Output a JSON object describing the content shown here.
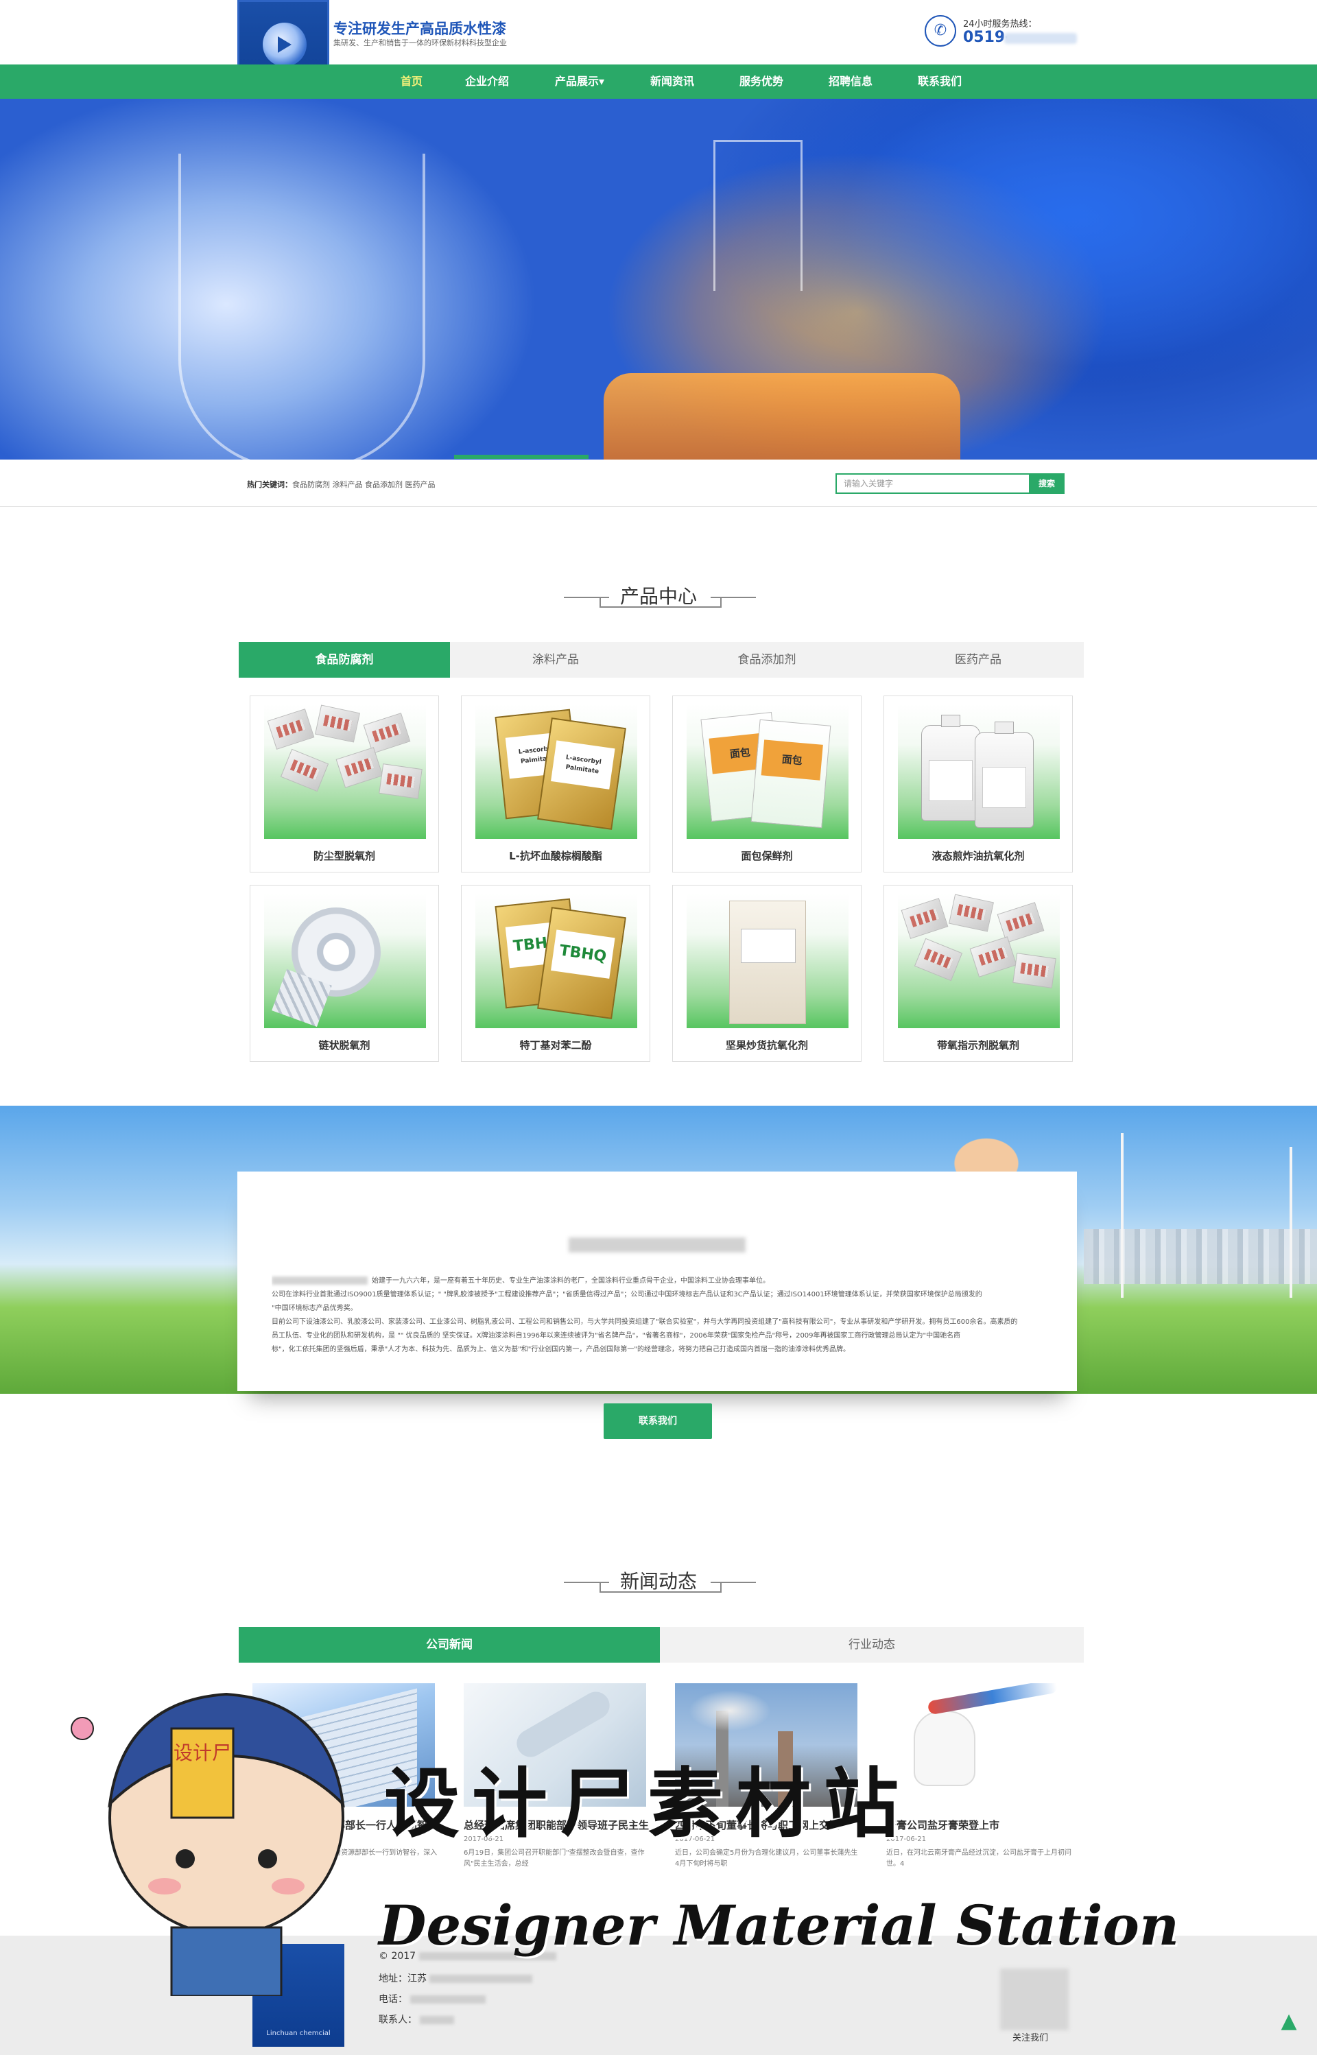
{
  "header": {
    "logo_text": "Linchuan chemcial",
    "slogan": "专注研发生产高品质水性漆",
    "slogan_sub": "集研发、生产和销售于一体的环保新材料科技型企业",
    "hotline_label": "24小时服务热线：",
    "hotline_prefix": "0519-"
  },
  "nav": {
    "items": [
      "首页",
      "企业介绍",
      "产品展示▾",
      "新闻资讯",
      "服务优势",
      "招聘信息",
      "联系我们"
    ],
    "active_index": 0
  },
  "search": {
    "hot_label": "热门关键词：",
    "hot_words": "食品防腐剂  涂料产品  食品添加剂  医药产品",
    "placeholder": "请输入关键字",
    "button": "搜索"
  },
  "products": {
    "title": "产品中心",
    "tabs": [
      "食品防腐剂",
      "涂料产品",
      "食品添加剂",
      "医药产品"
    ],
    "active_tab": 0,
    "items": [
      {
        "name": "防尘型脱氧剂",
        "image": "silver-sachets"
      },
      {
        "name": "L-抗坏血酸棕榈酸酯",
        "image": "gold-bags",
        "label": "L-ascorbyl Palmitate"
      },
      {
        "name": "面包保鲜剂",
        "image": "bread-bags",
        "label": "面包"
      },
      {
        "name": "液态煎炸油抗氧化剂",
        "image": "plastic-jugs"
      },
      {
        "name": "链状脱氧剂",
        "image": "sachet-roll"
      },
      {
        "name": "特丁基对苯二酚",
        "image": "gold-bags",
        "label": "TBHQ"
      },
      {
        "name": "坚果炒货抗氧化剂",
        "image": "powder-bag"
      },
      {
        "name": "带氧指示剂脱氧剂",
        "image": "silver-sachets"
      }
    ]
  },
  "about": {
    "lines": [
      "始建于一九六六年，是一座有着五十年历史、专业生产油漆涂料的老厂，全国涂料行业重点骨干企业，中国涂料工业协会理事单位。",
      "公司在涂料行业首批通过ISO9001质量管理体系认证；\"   \"牌乳胶漆被授予\"工程建设推荐产品\"；\"省质量信得过产品\"；公司通过中国环境标志产品认证和3C产品认证；通过ISO14001环境管理体系认证，并荣获国家环境保护总局颁发的",
      "\"中国环境标志产品优秀奖。",
      "目前公司下设油漆公司、乳胶漆公司、家装漆公司、工业漆公司、树脂乳液公司、工程公司和销售公司，与大学共同投资组建了\"联合实验室\"，并与大学再同投资组建了\"高科技有限公司\"，专业从事研发和产学研开发。拥有员工600余名。高素质的",
      "员工队伍、专业化的团队和研发机构，是 \"\" 优良品质的 坚实保证。X牌油漆涂料自1996年以来连续被评为\"省名牌产品\"，\"省著名商标\"，2006年荣获\"国家免检产品\"称号，2009年再被国家工商行政管理总局认定为\"中国驰名商",
      "标\"，化工依托集团的坚强后盾，秉承\"人才为本、科技为先、品质为上、信义为基\"和\"行业创国内第一，产品创国际第一\"的经营理念，将努力把自己打造成国内首屈一指的油漆涂料优秀品牌。"
    ],
    "button": "联系我们"
  },
  "news": {
    "title": "新闻动态",
    "tabs": [
      "公司新闻",
      "行业动态"
    ],
    "active_tab": 0,
    "items": [
      {
        "title": "总经理和人力资源部部长一行人来到智谷",
        "date": "2017-06-21",
        "desc": "6月18日，集团总经理和人力资源部部长一行到访智谷，深入集"
      },
      {
        "title": "总经理出席集团职能部门领导班子民主生",
        "date": "2017-06-21",
        "desc": "6月19日，集团公司召开职能部门\"查摆整改会暨自查，查作风\"民主生活会，总经"
      },
      {
        "title": "四月中下旬董事长将与职工网上交流",
        "date": "2017-06-21",
        "desc": "近日，公司会确定5月份为合理化建议月，公司董事长蒲先生4月下旬时将与职"
      },
      {
        "title": "牙膏公司盐牙膏荣登上市",
        "date": "2017-06-21",
        "desc": "近日，在河北云南牙膏产品经过沉淀，公司盐牙膏于上月初问世。4"
      }
    ]
  },
  "footer": {
    "copyright": "© 2017",
    "address_label": "地址：",
    "address_value": "江苏",
    "phone_label": "电话：",
    "contact_label": "联系人：",
    "follow_label": "关注我们"
  },
  "watermark": {
    "cn": "设计尸素材站",
    "en": "Designer Material Station",
    "badge": "设计尸"
  },
  "colors": {
    "brand_green": "#2aa968",
    "brand_blue": "#1f56b8"
  }
}
